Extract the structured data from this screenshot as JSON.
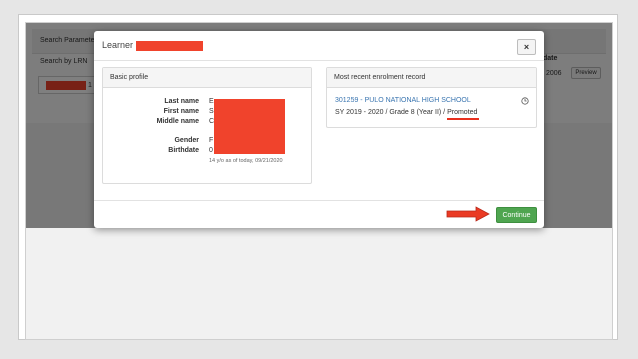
{
  "background": {
    "search_panel_title": "Search Parameter",
    "search_by_label": "Search by LRN",
    "input_suffix": "1",
    "column_header": "date",
    "row_date": "2006",
    "preview_label": "Preview"
  },
  "modal": {
    "title": "Learner",
    "close_glyph": "×",
    "basic_profile": {
      "header": "Basic profile",
      "fields": [
        {
          "label": "Last name",
          "value": "E"
        },
        {
          "label": "First name",
          "value": "S"
        },
        {
          "label": "Middle name",
          "value": "C"
        },
        {
          "label": "Gender",
          "value": "F"
        },
        {
          "label": "Birthdate",
          "value": "0"
        }
      ],
      "age_note": "14 y/o as of today, 09/21/2020"
    },
    "enrolment": {
      "header": "Most recent enrolment record",
      "school": "301259 - PULO NATIONAL HIGH SCHOOL",
      "details": "SY 2019 - 2020 / Grade 8 (Year II) / ",
      "status": "Promoted"
    },
    "continue_label": "Continue"
  },
  "colors": {
    "redaction": "#f0432c",
    "continue": "#4fa550",
    "link": "#3a75b0"
  },
  "icons": {
    "close": "close-icon",
    "clock": "clock-icon",
    "arrow": "arrow-right-icon"
  }
}
